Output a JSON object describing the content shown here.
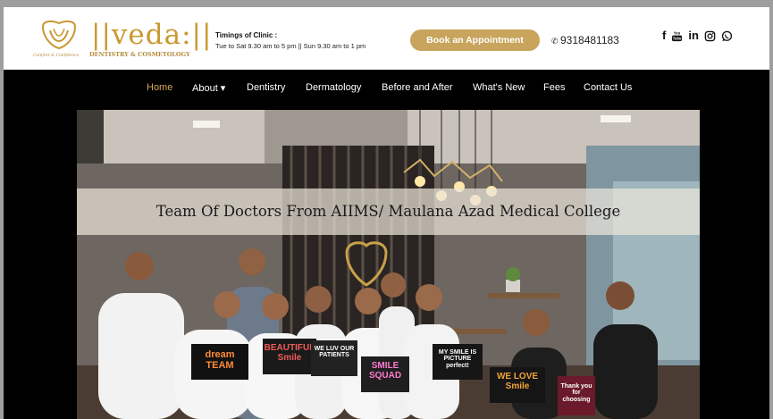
{
  "header": {
    "logo_tagline": "Comfort & Confidence",
    "logo_name": "||veda:||",
    "logo_subtitle": "DENTISTRY & COSMETOLOGY",
    "timings_title": "Timings of Clinic :",
    "timings_text": "Tue to Sat 9.30 am to 5 pm || Sun 9.30 am to 1 pm",
    "book_label": "Book an Appointment",
    "phone": "9318481183",
    "social": [
      "facebook-icon",
      "youtube-icon",
      "linkedin-icon",
      "instagram-icon",
      "whatsapp-icon"
    ]
  },
  "nav": {
    "items": [
      {
        "label": "Home",
        "active": true
      },
      {
        "label": "About ▾"
      },
      {
        "label": "Dentistry"
      },
      {
        "label": "Dermatology"
      },
      {
        "label": "Before and After"
      },
      {
        "label": "What's New"
      },
      {
        "label": "Fees"
      },
      {
        "label": "Contact Us"
      }
    ]
  },
  "hero": {
    "caption": "Team Of Doctors From AIIMS/ Maulana Azad Medical College",
    "signs": [
      "dream TEAM",
      "BEAUTIFUL Smile",
      "WE LUV OUR PATIENTS",
      "SMILE SQUAD",
      "MY SMILE IS PICTURE perfect!",
      "WE LOVE Smile",
      "Thank you for choosing"
    ]
  },
  "colors": {
    "gold": "#c8a45c",
    "nav_active": "#d4a955",
    "nav_bg": "#000000"
  }
}
